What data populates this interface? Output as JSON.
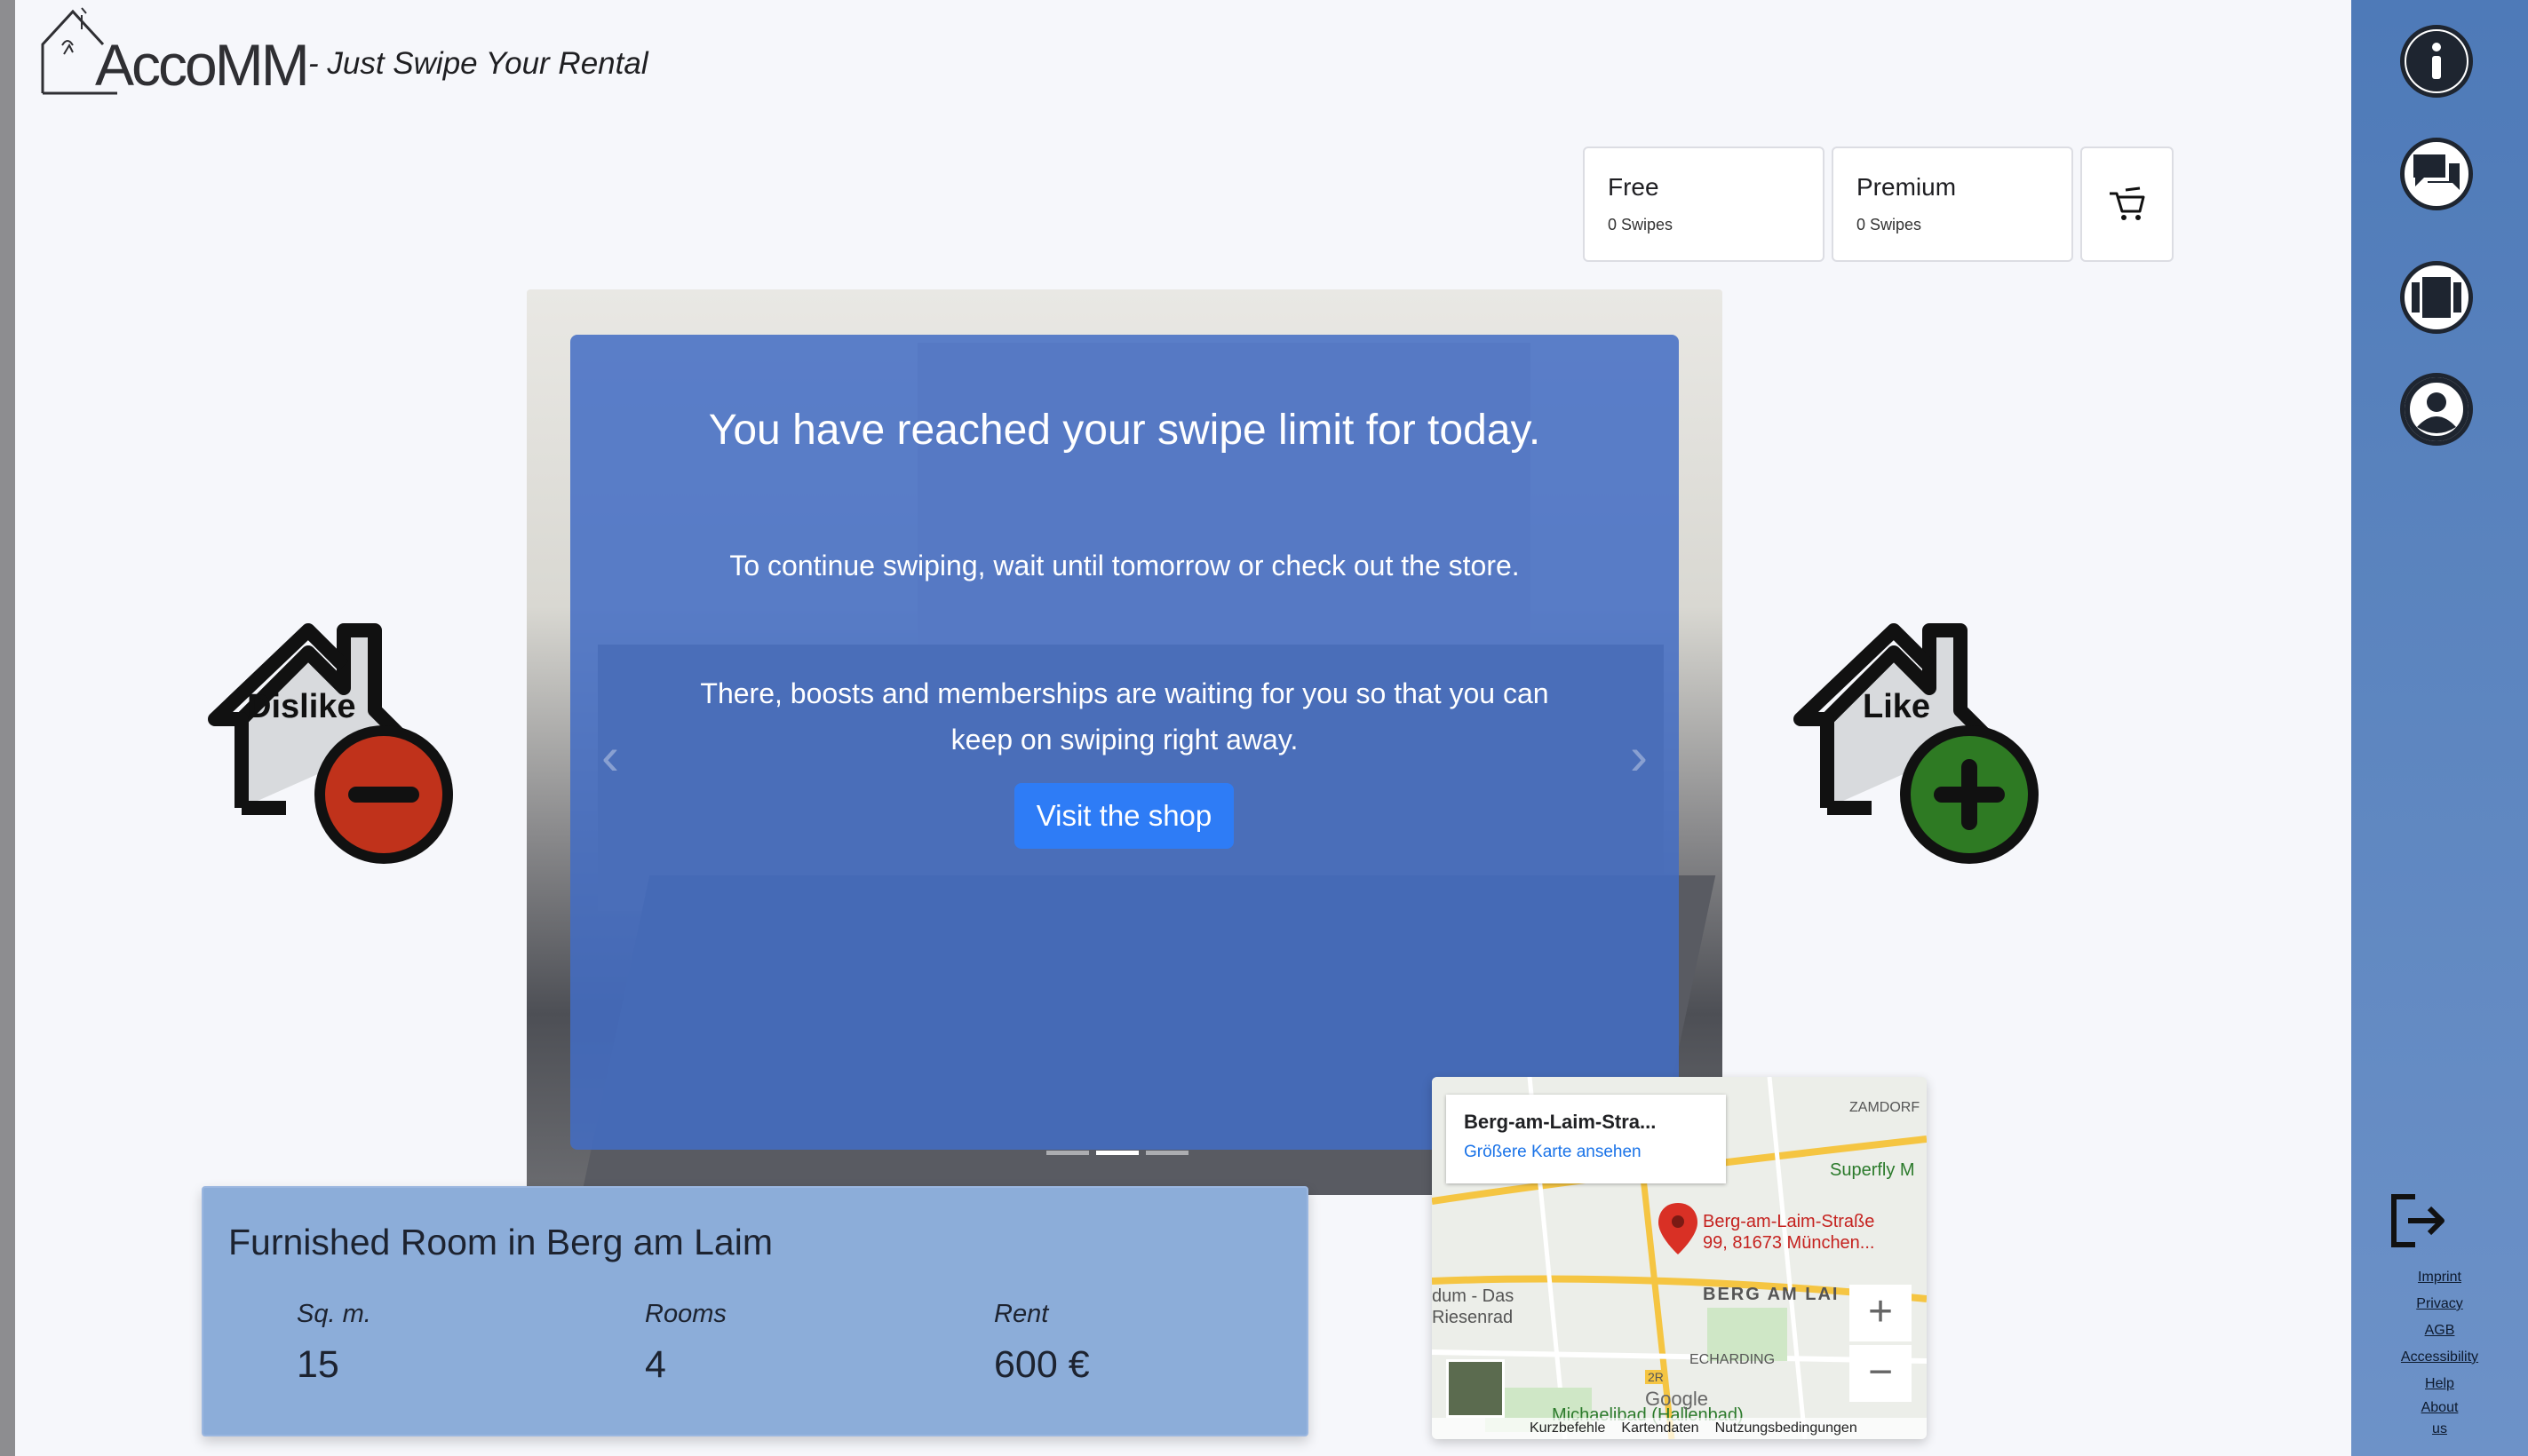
{
  "header": {
    "logo_text": "AccoMM",
    "tagline": "- Just Swipe Your Rental"
  },
  "plans": [
    {
      "name": "Free",
      "swipes": "0 Swipes"
    },
    {
      "name": "Premium",
      "swipes": "0 Swipes"
    }
  ],
  "cart": {
    "icon": "cart-icon"
  },
  "overlay": {
    "title": "You have reached your swipe limit for today.",
    "line1": "To continue swiping, wait until tomorrow or check out the store.",
    "line2": "There, boosts and memberships are waiting for you so that you can keep on swiping right away.",
    "button": "Visit the shop"
  },
  "actions": {
    "dislike_label": "Dislike",
    "like_label": "Like",
    "dislike_color": "#c0321b",
    "like_color": "#2e7a23"
  },
  "listing": {
    "title": "Furnished Room in Berg am Laim",
    "stats": [
      {
        "label": "Sq. m.",
        "value": "15"
      },
      {
        "label": "Rooms",
        "value": "4"
      },
      {
        "label": "Rent",
        "value": "600 €"
      }
    ]
  },
  "map": {
    "card_title": "Berg-am-Laim-Stra...",
    "card_link": "Größere Karte ansehen",
    "pin_label_1": "Berg-am-Laim-Straße",
    "pin_label_2": "99, 81673 München...",
    "labels": [
      "ZAMDORF",
      "Superfly M",
      "BERG AM LAI",
      "dum - Das",
      "Riesenrad",
      "ECHARDING",
      "Michaelibad (Hallenbad)",
      "2R"
    ],
    "zoom_in": "+",
    "zoom_out": "−",
    "footer": [
      "Kurzbefehle",
      "Kartendaten",
      "Nutzungsbedingungen"
    ],
    "brand": "Google"
  },
  "sidebar": {
    "icons": [
      "info-icon",
      "chat-icon",
      "swipe-cards-icon",
      "profile-icon"
    ],
    "logout_icon": "logout-icon",
    "links": [
      "Imprint",
      "Privacy",
      "AGB",
      "Accessibility",
      "Help",
      "About us"
    ],
    "accent": "#4e7ab8"
  }
}
